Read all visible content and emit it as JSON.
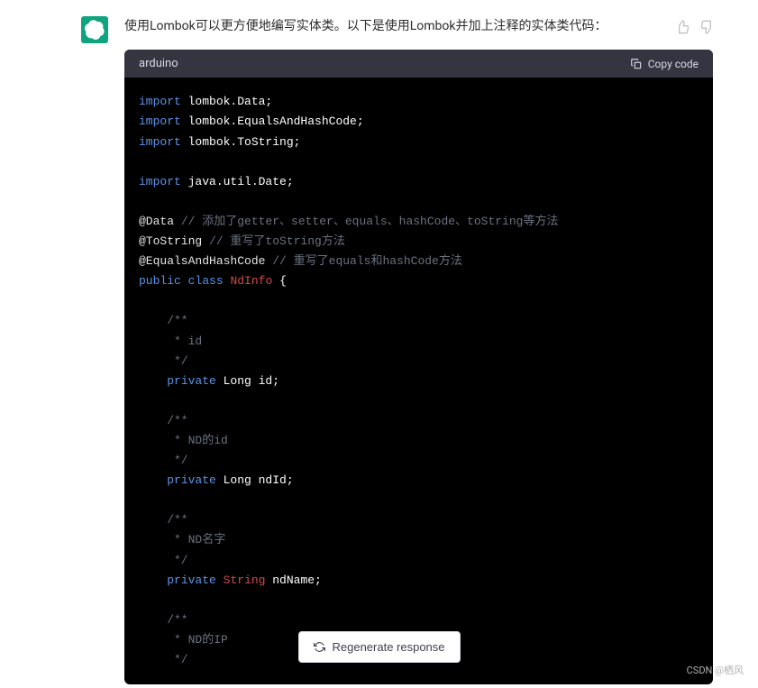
{
  "response": {
    "text": "使用Lombok可以更方便地编写实体类。以下是使用Lombok并加上注释的实体类代码："
  },
  "code": {
    "language": "arduino",
    "copy_label": "Copy code",
    "tokens": [
      [
        {
          "t": "import",
          "c": "kw"
        },
        {
          "t": " lombok.Data;",
          "c": ""
        }
      ],
      [
        {
          "t": "import",
          "c": "kw"
        },
        {
          "t": " lombok.EqualsAndHashCode;",
          "c": ""
        }
      ],
      [
        {
          "t": "import",
          "c": "kw"
        },
        {
          "t": " lombok.ToString;",
          "c": ""
        }
      ],
      [],
      [
        {
          "t": "import",
          "c": "kw"
        },
        {
          "t": " java.util.Date;",
          "c": ""
        }
      ],
      [],
      [
        {
          "t": "@Data",
          "c": "ann"
        },
        {
          "t": " // 添加了getter、setter、equals、hashCode、toString等方法",
          "c": "com"
        }
      ],
      [
        {
          "t": "@ToString",
          "c": "ann"
        },
        {
          "t": " // 重写了toString方法",
          "c": "com"
        }
      ],
      [
        {
          "t": "@EqualsAndHashCode",
          "c": "ann"
        },
        {
          "t": " // 重写了equals和hashCode方法",
          "c": "com"
        }
      ],
      [
        {
          "t": "public",
          "c": "kw"
        },
        {
          "t": " ",
          "c": ""
        },
        {
          "t": "class",
          "c": "kw"
        },
        {
          "t": " ",
          "c": ""
        },
        {
          "t": "NdInfo",
          "c": "cls"
        },
        {
          "t": " {",
          "c": ""
        }
      ],
      [],
      [
        {
          "t": "    /**",
          "c": "com"
        }
      ],
      [
        {
          "t": "     * id",
          "c": "com"
        }
      ],
      [
        {
          "t": "     */",
          "c": "com"
        }
      ],
      [
        {
          "t": "    ",
          "c": ""
        },
        {
          "t": "private",
          "c": "kw"
        },
        {
          "t": " Long id;",
          "c": ""
        }
      ],
      [],
      [
        {
          "t": "    /**",
          "c": "com"
        }
      ],
      [
        {
          "t": "     * ND的id",
          "c": "com"
        }
      ],
      [
        {
          "t": "     */",
          "c": "com"
        }
      ],
      [
        {
          "t": "    ",
          "c": ""
        },
        {
          "t": "private",
          "c": "kw"
        },
        {
          "t": " Long ndId;",
          "c": ""
        }
      ],
      [],
      [
        {
          "t": "    /**",
          "c": "com"
        }
      ],
      [
        {
          "t": "     * ND名字",
          "c": "com"
        }
      ],
      [
        {
          "t": "     */",
          "c": "com"
        }
      ],
      [
        {
          "t": "    ",
          "c": ""
        },
        {
          "t": "private",
          "c": "kw"
        },
        {
          "t": " ",
          "c": ""
        },
        {
          "t": "String",
          "c": "cls"
        },
        {
          "t": " ndName;",
          "c": ""
        }
      ],
      [],
      [
        {
          "t": "    /**",
          "c": "com"
        }
      ],
      [
        {
          "t": "     * ND的IP",
          "c": "com"
        }
      ],
      [
        {
          "t": "     */",
          "c": "com"
        }
      ]
    ]
  },
  "regenerate_label": "Regenerate response",
  "watermark": "CSDN @栖风"
}
